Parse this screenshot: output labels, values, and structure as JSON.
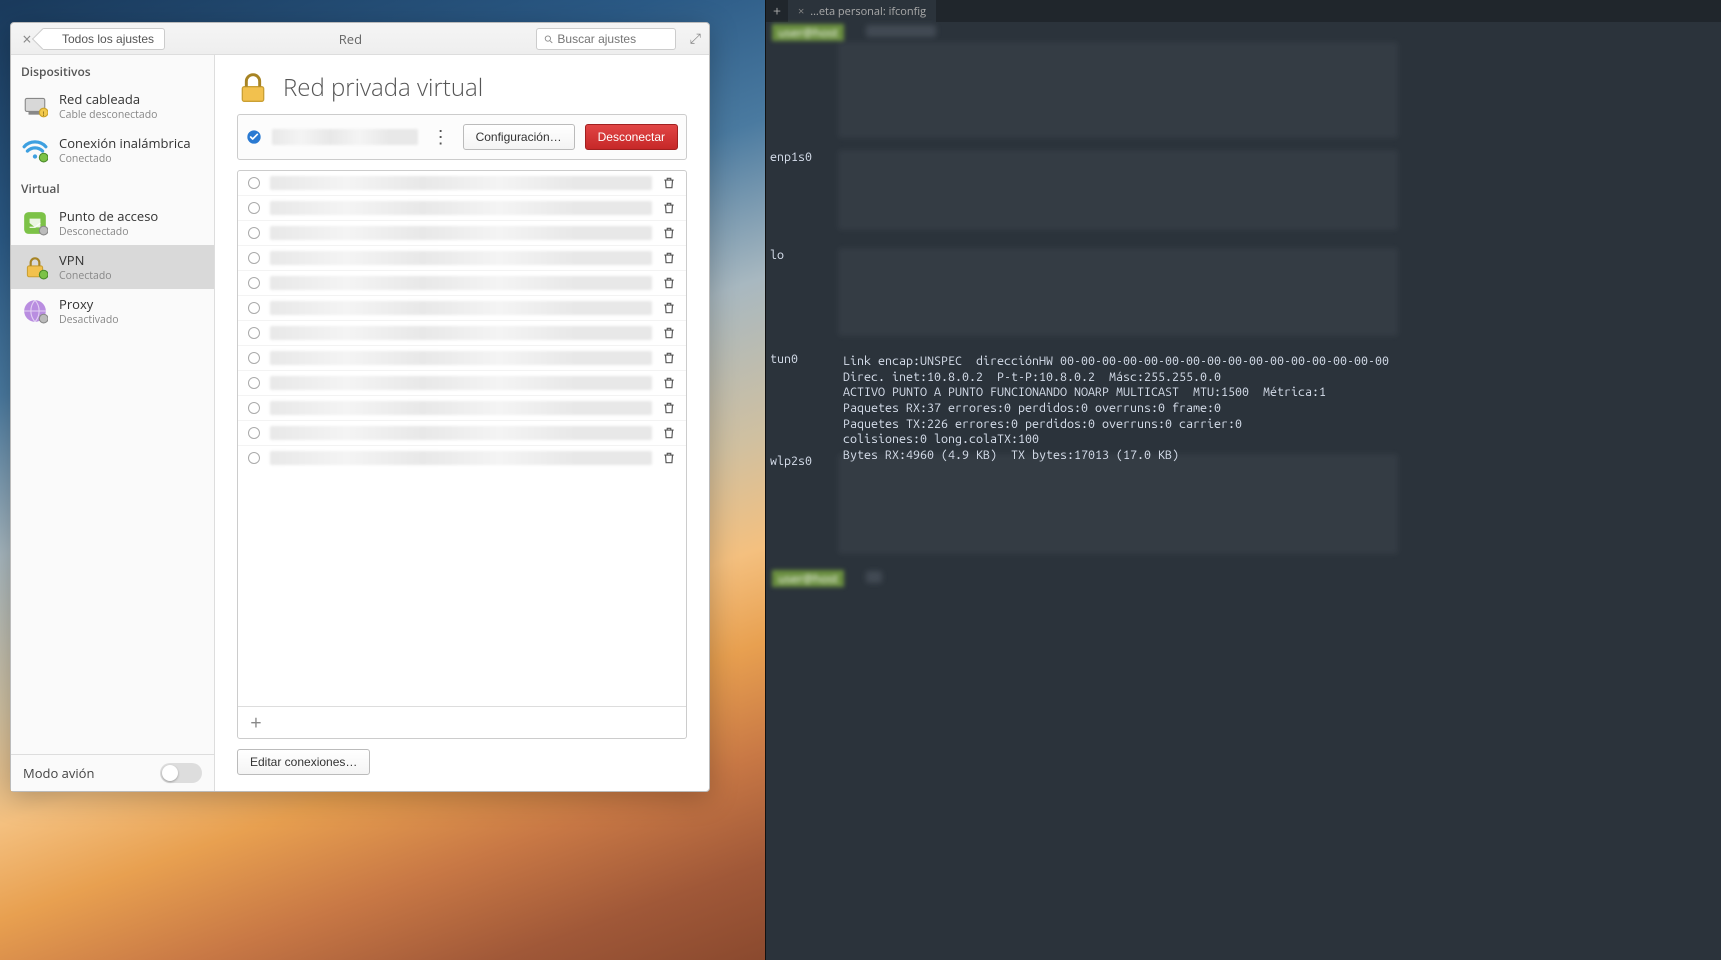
{
  "window": {
    "breadcrumb": "Todos los ajustes",
    "title": "Red",
    "search_placeholder": "Buscar ajustes"
  },
  "sidebar": {
    "section_devices": "Dispositivos",
    "section_virtual": "Virtual",
    "items": [
      {
        "id": "wired",
        "label": "Red cableada",
        "sub": "Cable desconectado"
      },
      {
        "id": "wifi",
        "label": "Conexión inalámbrica",
        "sub": "Conectado"
      },
      {
        "id": "hotspot",
        "label": "Punto de acceso",
        "sub": "Desconectado"
      },
      {
        "id": "vpn",
        "label": "VPN",
        "sub": "Conectado"
      },
      {
        "id": "proxy",
        "label": "Proxy",
        "sub": "Desactivado"
      }
    ],
    "airplane_label": "Modo avión"
  },
  "vpn": {
    "page_title": "Red privada virtual",
    "configure_btn": "Configuración…",
    "disconnect_btn": "Desconectar",
    "edit_connections_btn": "Editar conexiones…",
    "row_count": 12
  },
  "terminal": {
    "tab_title": "…eta personal: ifconfig",
    "ifaces": {
      "enp1s0": "enp1s0",
      "lo": "lo",
      "tun0": "tun0",
      "wlp2s0": "wlp2s0"
    },
    "tun0_text": "Link encap:UNSPEC  direcciónHW 00-00-00-00-00-00-00-00-00-00-00-00-00-00-00-00\nDirec. inet:10.8.0.2  P-t-P:10.8.0.2  Másc:255.255.0.0\nACTIVO PUNTO A PUNTO FUNCIONANDO NOARP MULTICAST  MTU:1500  Métrica:1\nPaquetes RX:37 errores:0 perdidos:0 overruns:0 frame:0\nPaquetes TX:226 errores:0 perdidos:0 overruns:0 carrier:0\ncolisiones:0 long.colaTX:100\nBytes RX:4960 (4.9 KB)  TX bytes:17013 (17.0 KB)"
  }
}
